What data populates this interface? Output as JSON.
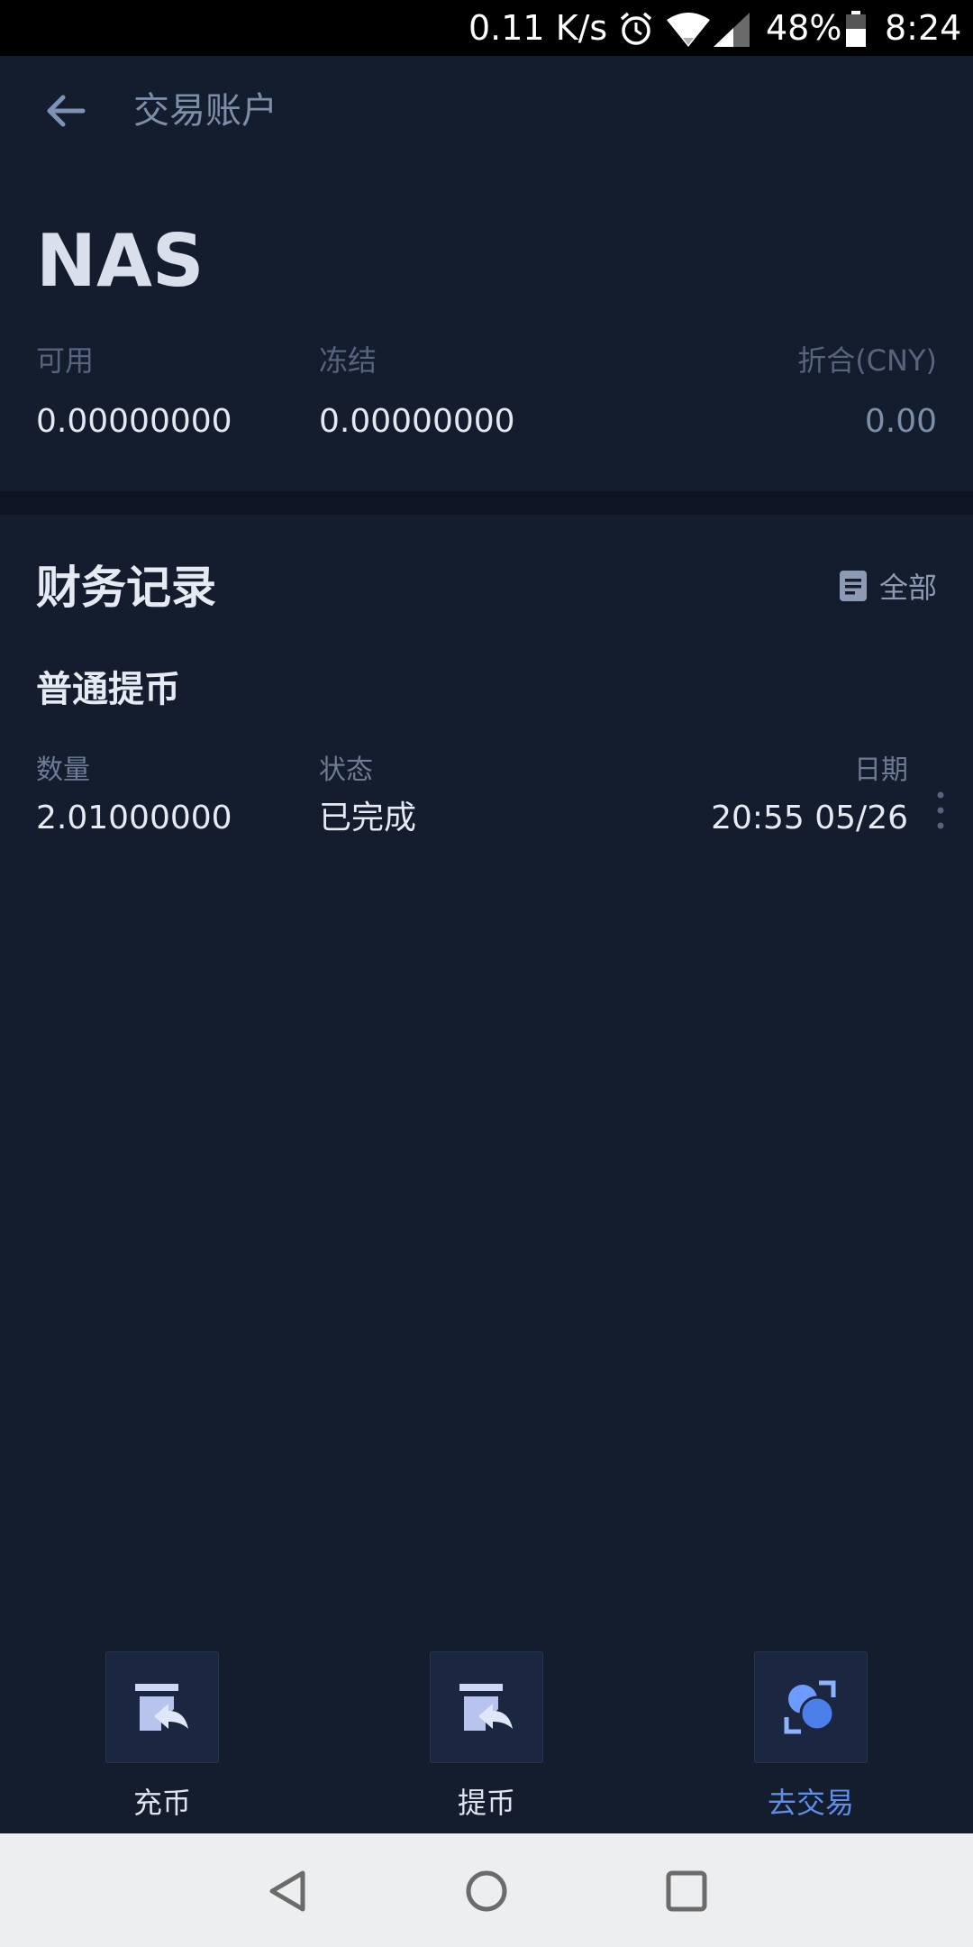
{
  "status_bar": {
    "net_speed": "0.11 K/s",
    "battery_percent": "48%",
    "time": "8:24",
    "icons": [
      "alarm-icon",
      "wifi-icon",
      "signal-icon",
      "battery-icon"
    ]
  },
  "header": {
    "title": "交易账户",
    "back_icon": "arrow-left-icon"
  },
  "account": {
    "coin": "NAS",
    "available_label": "可用",
    "available_value": "0.00000000",
    "frozen_label": "冻结",
    "frozen_value": "0.00000000",
    "cny_label": "折合(CNY)",
    "cny_value": "0.00"
  },
  "records": {
    "title": "财务记录",
    "all_label": "全部",
    "items": [
      {
        "type": "普通提币",
        "amount_label": "数量",
        "amount": "2.01000000",
        "status_label": "状态",
        "status": "已完成",
        "date_label": "日期",
        "date": "20:55 05/26"
      }
    ]
  },
  "actions": [
    {
      "label": "充币",
      "icon": "deposit-icon"
    },
    {
      "label": "提币",
      "icon": "withdraw-icon"
    },
    {
      "label": "去交易",
      "icon": "trade-icon",
      "active": true
    }
  ],
  "colors": {
    "background": "#141d2e",
    "divider": "#0d1522",
    "accent": "#5e8fe8",
    "muted": "#7d8ea8"
  }
}
